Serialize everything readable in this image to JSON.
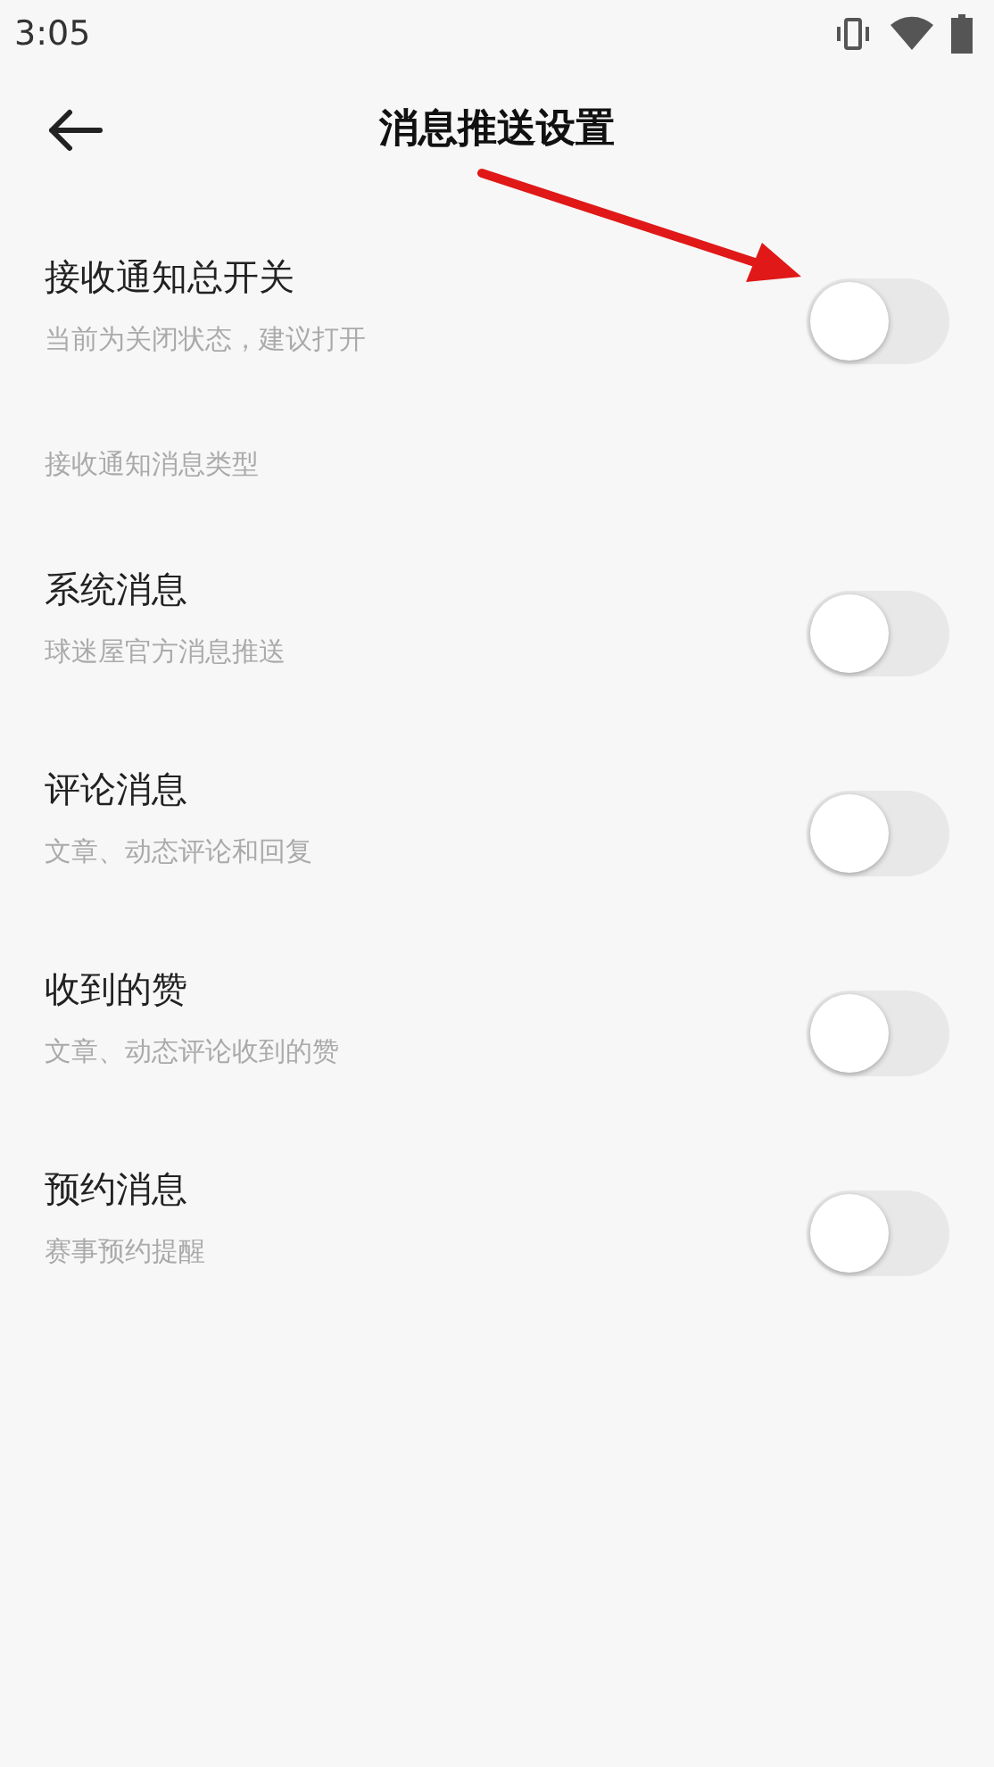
{
  "status_bar": {
    "time": "3:05"
  },
  "header": {
    "title": "消息推送设置"
  },
  "master": {
    "title": "接收通知总开关",
    "subtitle": "当前为关闭状态，建议打开",
    "on": false
  },
  "section_label": "接收通知消息类型",
  "items": [
    {
      "title": "系统消息",
      "subtitle": "球迷屋官方消息推送",
      "on": false
    },
    {
      "title": "评论消息",
      "subtitle": "文章、动态评论和回复",
      "on": false
    },
    {
      "title": "收到的赞",
      "subtitle": "文章、动态评论收到的赞",
      "on": false
    },
    {
      "title": "预约消息",
      "subtitle": "赛事预约提醒",
      "on": false
    }
  ]
}
